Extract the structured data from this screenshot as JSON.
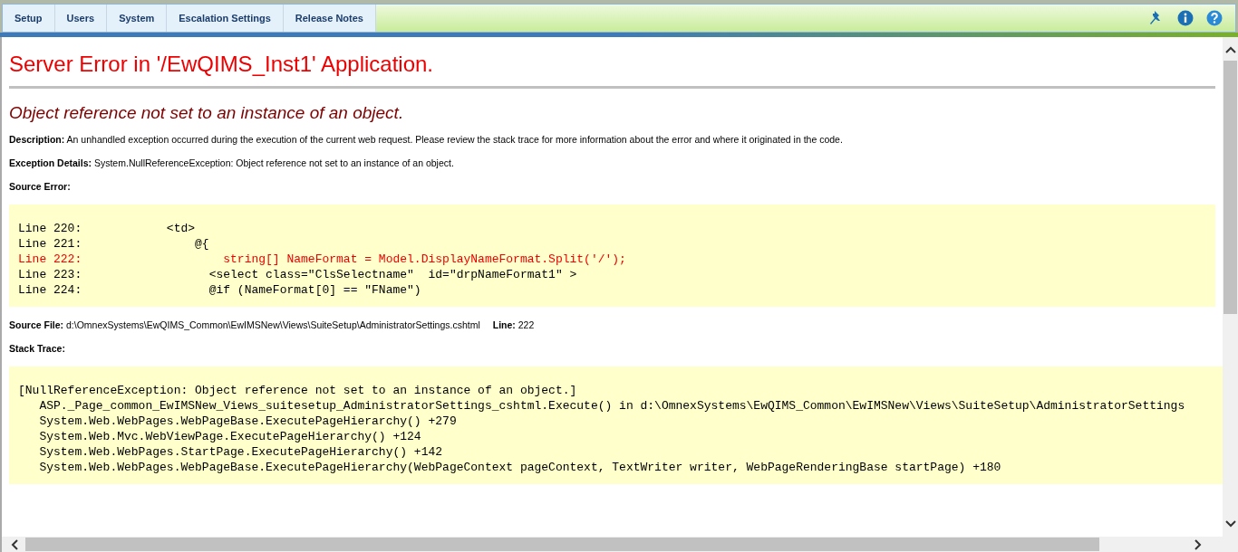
{
  "tabs": [
    {
      "label": "Setup"
    },
    {
      "label": "Users"
    },
    {
      "label": "System"
    },
    {
      "label": "Escalation Settings"
    },
    {
      "label": "Release Notes"
    }
  ],
  "title": "Server Error in '/EwQIMS_Inst1' Application.",
  "subtitle": "Object reference not set to an instance of an object.",
  "description": {
    "label": "Description:",
    "text": "An unhandled exception occurred during the execution of the current web request. Please review the stack trace for more information about the error and where it originated in the code."
  },
  "exception_details": {
    "label": "Exception Details:",
    "text": "System.NullReferenceException: Object reference not set to an instance of an object."
  },
  "source_error": {
    "label": "Source Error:",
    "lines": [
      {
        "number": "Line 220:",
        "code": "        <td>",
        "highlighted": false
      },
      {
        "number": "Line 221:",
        "code": "            @{",
        "highlighted": false
      },
      {
        "number": "Line 222:",
        "code": "                string[] NameFormat = Model.DisplayNameFormat.Split('/');",
        "highlighted": true
      },
      {
        "number": "Line 223:",
        "code": "              <select class=\"ClsSelectname\"  id=\"drpNameFormat1\" >",
        "highlighted": false
      },
      {
        "number": "Line 224:",
        "code": "              @if (NameFormat[0] == \"FName\")",
        "highlighted": false
      }
    ]
  },
  "source_file": {
    "label": "Source File:",
    "path": "d:\\OmnexSystems\\EwQIMS_Common\\EwIMSNew\\Views\\SuiteSetup\\AdministratorSettings.cshtml",
    "line_label": "Line:",
    "line": "222"
  },
  "stack_trace": {
    "label": "Stack Trace:",
    "lines": [
      "[NullReferenceException: Object reference not set to an instance of an object.]",
      "   ASP._Page_common_EwIMSNew_Views_suitesetup_AdministratorSettings_cshtml.Execute() in d:\\OmnexSystems\\EwQIMS_Common\\EwIMSNew\\Views\\SuiteSetup\\AdministratorSettings",
      "   System.Web.WebPages.WebPageBase.ExecutePageHierarchy() +279",
      "   System.Web.Mvc.WebViewPage.ExecutePageHierarchy() +124",
      "   System.Web.WebPages.StartPage.ExecutePageHierarchy() +142",
      "   System.Web.WebPages.WebPageBase.ExecutePageHierarchy(WebPageContext pageContext, TextWriter writer, WebPageRenderingBase startPage) +180"
    ]
  }
}
